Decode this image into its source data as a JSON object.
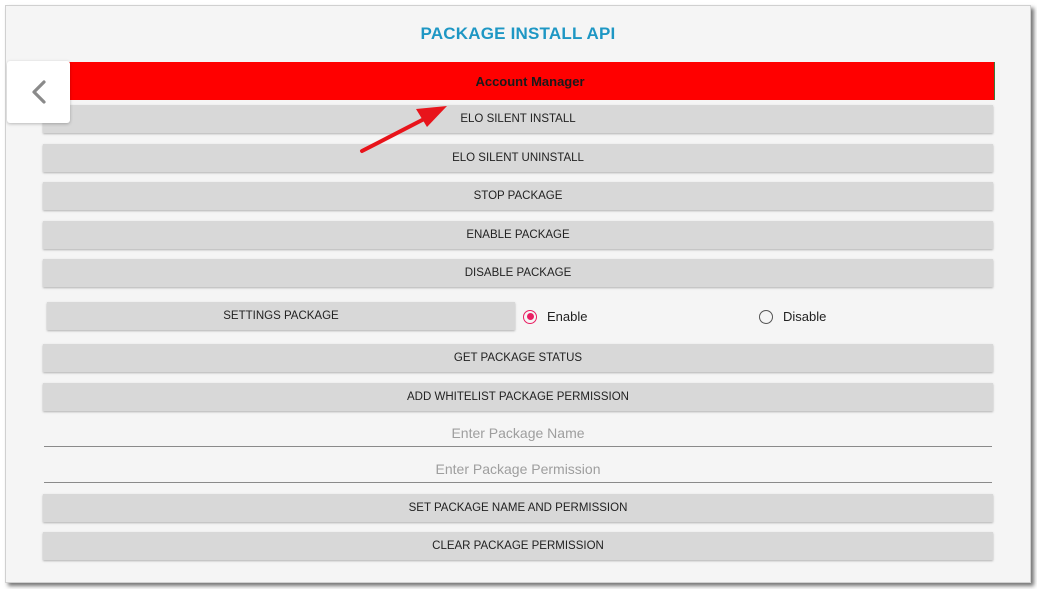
{
  "header": {
    "title": "PACKAGE INSTALL API"
  },
  "nav": {
    "back_icon": "chevron-left-icon"
  },
  "buttons": {
    "account_manager": "Account Manager",
    "elo_silent_install": "ELO SILENT INSTALL",
    "elo_silent_uninstall": "ELO SILENT UNINSTALL",
    "stop_package": "STOP PACKAGE",
    "enable_package": "ENABLE PACKAGE",
    "disable_package": "DISABLE PACKAGE",
    "settings_package": "SETTINGS PACKAGE",
    "get_package_status": "GET PACKAGE STATUS",
    "add_whitelist_package_permission": "ADD WHITELIST PACKAGE PERMISSION",
    "set_package_name_and_permission": "SET PACKAGE NAME AND PERMISSION",
    "clear_package_permission": "CLEAR PACKAGE PERMISSION"
  },
  "settings_radio": {
    "options": [
      "Enable",
      "Disable"
    ],
    "selected": "Enable"
  },
  "inputs": {
    "package_name": {
      "placeholder": "Enter Package Name",
      "value": ""
    },
    "package_permission": {
      "placeholder": "Enter Package Permission",
      "value": ""
    }
  },
  "colors": {
    "title": "#1e97c4",
    "highlight_button": "#ff0000",
    "button": "#d8d8d8",
    "radio_checked": "#e91e63",
    "annotation_arrow": "#e8141b"
  },
  "annotation": {
    "icon": "red-arrow-icon",
    "points_to": "account-manager-button"
  }
}
